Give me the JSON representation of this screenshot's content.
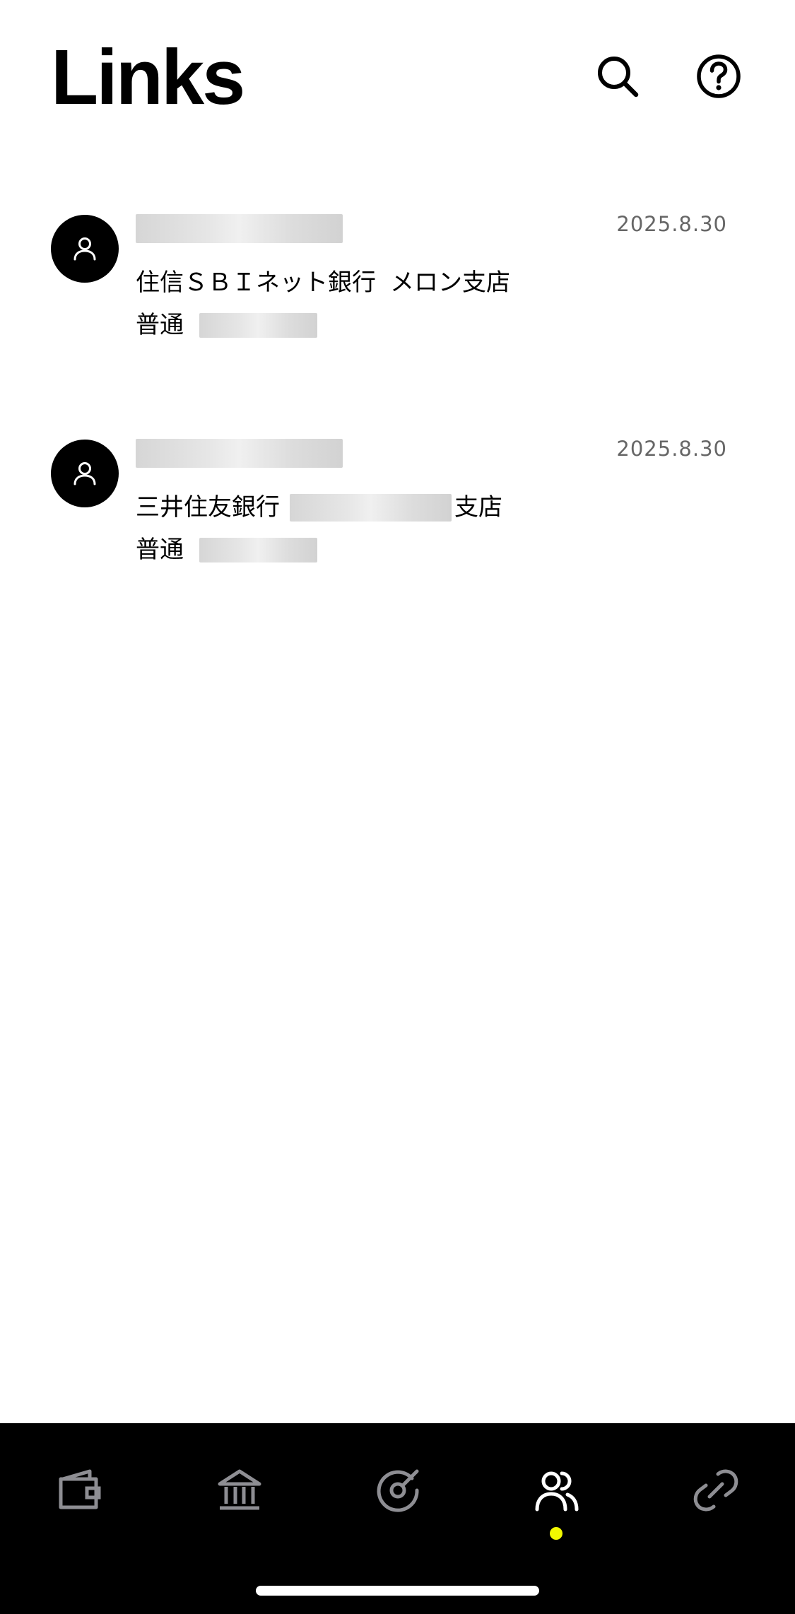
{
  "header": {
    "title": "Links",
    "icons": {
      "search": "search-icon",
      "help": "help-icon"
    }
  },
  "links": [
    {
      "date": "2025.8.30",
      "bank": "住信ＳＢＩネット銀行",
      "branch": "メロン支店",
      "account_type": "普通"
    },
    {
      "date": "2025.8.30",
      "bank": "三井住友銀行",
      "branch_suffix": "支店",
      "account_type": "普通"
    }
  ],
  "tabbar": {
    "tabs": [
      {
        "icon": "wallet-icon"
      },
      {
        "icon": "bank-icon"
      },
      {
        "icon": "target-icon"
      },
      {
        "icon": "users-icon",
        "active": true
      },
      {
        "icon": "link-icon"
      }
    ],
    "active_color": "#f2f800",
    "inactive_color": "#8e8e93"
  }
}
